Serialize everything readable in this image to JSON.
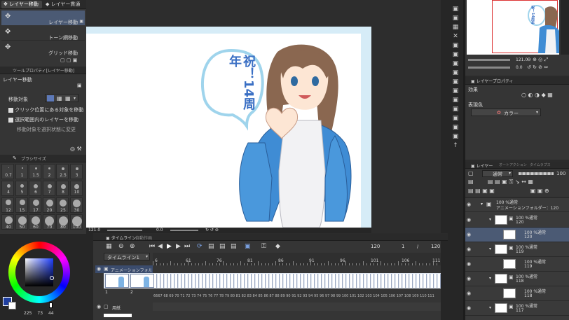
{
  "left_tabs": {
    "tab1": "レイヤー移動",
    "tab2": "レイヤー貫通"
  },
  "subtools": [
    {
      "label": "レイヤー移動",
      "selected": true
    },
    {
      "label": "トーン網移動",
      "selected": false
    },
    {
      "label": "グリッド移動",
      "selected": false
    }
  ],
  "tool_property": {
    "header": "ツールプロパティ[レイヤー移動]",
    "title": "レイヤー移動",
    "target_label": "移動対象",
    "opt1": "クリック位置にある対象を移動",
    "opt2": "選択範囲内のレイヤーを移動",
    "opt3": "移動対象を選択状態に変更"
  },
  "brush_size": {
    "header": "ブラシサイズ",
    "rows": [
      [
        "0.7",
        "1",
        "1.5",
        "2",
        "2.5",
        "3"
      ],
      [
        "4",
        "5",
        "6",
        "7",
        "8",
        "10"
      ],
      [
        "12",
        "15",
        "17",
        "20",
        "25",
        "30"
      ],
      [
        "40",
        "50",
        "60",
        "70",
        "80",
        "100"
      ]
    ]
  },
  "color": {
    "main": "#1f3fa0",
    "values": [
      "225",
      "73",
      "44"
    ]
  },
  "canvas": {
    "banner": "祝！14周年",
    "zoom": "121.0",
    "angle": "0.0",
    "bg": "#ffffff",
    "frame_color": "#d6ecf7"
  },
  "timeline": {
    "tab1": "タイムライン",
    "tab2": "自動作画",
    "name": "タイムライン1",
    "frame_count": "120",
    "page": "1",
    "total": "120",
    "ruler": [
      "6",
      "61",
      "76",
      "81",
      "86",
      "91",
      "96",
      "101",
      "106",
      "111"
    ],
    "track_label": "アニメーションフォルダー",
    "paper_label": "用紙",
    "frame_nums_text": "6667 68 69 70 71 72 73 74 75 76 77 78 79 80 81 82 83 84 85 86 87 88 89 90 91 92 93 94 95 96 97 98 99 100 101 102 103 104 105 106 107 108 109 110 111",
    "cell1": "1",
    "cell2": "2"
  },
  "navigator": {
    "zoom": "121.0",
    "angle": "0.0",
    "thumb_text": "祝！14周年"
  },
  "layer_property": {
    "header": "レイヤープロパティ",
    "effect_label": "効果",
    "expression_label": "表現色",
    "color_option": "カラー"
  },
  "layer_panel": {
    "tabs": [
      "レイヤー",
      "オートアクション",
      "タイムラプス"
    ],
    "blend": "通常",
    "opacity": "100",
    "folder": {
      "line1": "100 %通常",
      "line2": "アニメーションフォルダー：120"
    },
    "items": [
      {
        "line1": "100 %通常",
        "line2": "120",
        "kind": "folder"
      },
      {
        "line1": "100 %通常",
        "line2": "120",
        "kind": "layer",
        "selected": true
      },
      {
        "line1": "100 %通常",
        "line2": "119",
        "kind": "folder"
      },
      {
        "line1": "100 %通常",
        "line2": "119",
        "kind": "layer"
      },
      {
        "line1": "100 %通常",
        "line2": "118",
        "kind": "folder"
      },
      {
        "line1": "100 %通常",
        "line2": "118",
        "kind": "layer"
      },
      {
        "line1": "100 %通常",
        "line2": "117",
        "kind": "folder"
      }
    ]
  }
}
